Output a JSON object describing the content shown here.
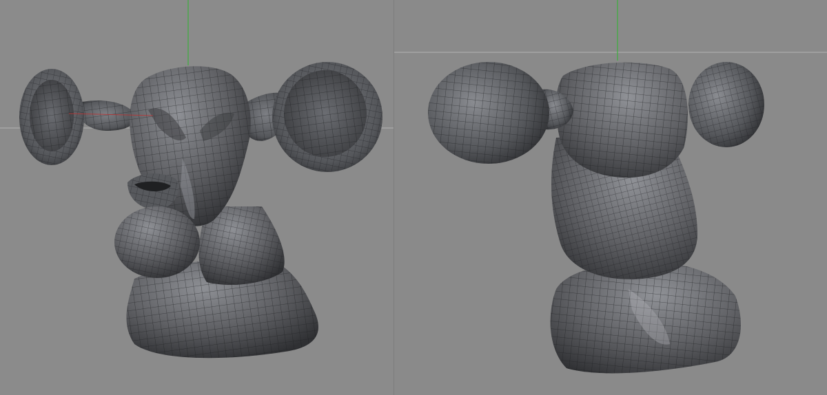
{
  "scene": {
    "left_viewport": {
      "view": "front-three-quarter",
      "object": "sculpted-creature-bust"
    },
    "right_viewport": {
      "view": "side-three-quarter",
      "object": "sculpted-creature-bust"
    }
  },
  "colors": {
    "viewport_bg": "#8a8a8a",
    "mesh_fill": "#5f6064",
    "mesh_light": "#8e9095",
    "mesh_dark": "#2f3033",
    "wire": "#1c1d1f",
    "axis_x": "#c03030",
    "axis_y": "#3cae3c",
    "horizon": "#b4b4b4"
  }
}
